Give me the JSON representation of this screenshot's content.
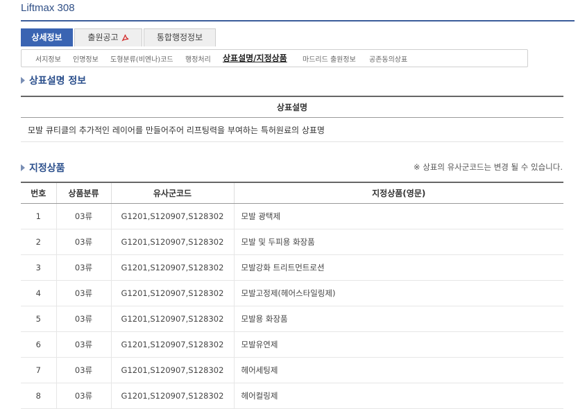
{
  "app": {
    "title": "Liftmax 308"
  },
  "tabs": [
    {
      "label": "상세정보",
      "active": true
    },
    {
      "label": "출원공고",
      "icon": "pdf-icon"
    },
    {
      "label": "통합행정정보"
    }
  ],
  "subtabs": [
    {
      "label": "서지정보"
    },
    {
      "label": "인명정보"
    },
    {
      "label": "도형분류(비엔나)코드"
    },
    {
      "label": "행정처리"
    },
    {
      "label": "상표설명/지정상품",
      "active": true
    },
    {
      "label": "마드리드 출원정보"
    },
    {
      "label": "공존동의상표"
    }
  ],
  "description_section": {
    "title": "상표설명 정보",
    "header": "상표설명",
    "text": "모발 큐티클의 추가적인 레이어를 만들어주어 리프팅력을 부여하는 특허원료의 상표명"
  },
  "goods_section": {
    "title": "지정상품",
    "note": "※ 상표의 유사군코드는 변경 될 수 있습니다.",
    "columns": [
      "번호",
      "상품분류",
      "유사군코드",
      "지정상품(영문)"
    ],
    "rows": [
      {
        "no": "1",
        "class": "03류",
        "codes": "G1201,S120907,S128302",
        "goods": "모발 광택제"
      },
      {
        "no": "2",
        "class": "03류",
        "codes": "G1201,S120907,S128302",
        "goods": "모발 및 두피용 화장품"
      },
      {
        "no": "3",
        "class": "03류",
        "codes": "G1201,S120907,S128302",
        "goods": "모발강화 트리트먼트로션"
      },
      {
        "no": "4",
        "class": "03류",
        "codes": "G1201,S120907,S128302",
        "goods": "모발고정제(헤어스타일링제)"
      },
      {
        "no": "5",
        "class": "03류",
        "codes": "G1201,S120907,S128302",
        "goods": "모발용 화장품"
      },
      {
        "no": "6",
        "class": "03류",
        "codes": "G1201,S120907,S128302",
        "goods": "모발유연제"
      },
      {
        "no": "7",
        "class": "03류",
        "codes": "G1201,S120907,S128302",
        "goods": "헤어세팅제"
      },
      {
        "no": "8",
        "class": "03류",
        "codes": "G1201,S120907,S128302",
        "goods": "헤어컬링제"
      }
    ]
  }
}
